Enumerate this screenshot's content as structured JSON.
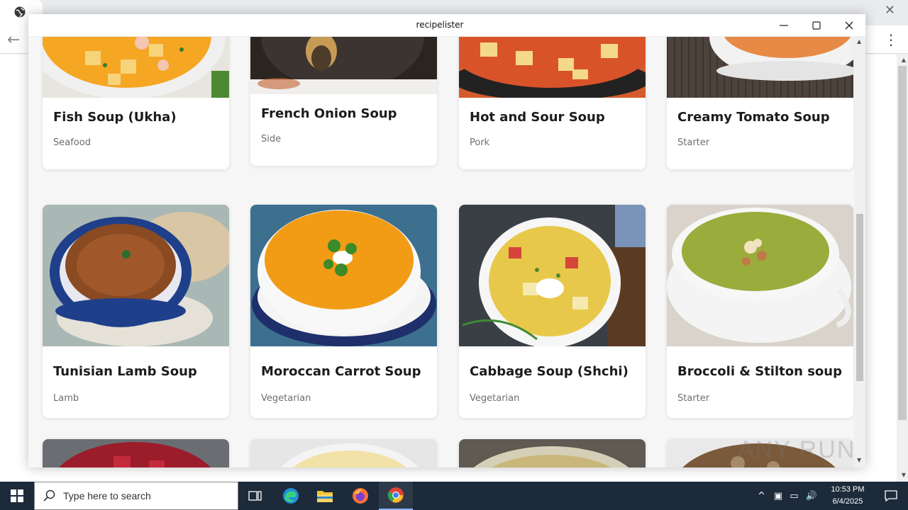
{
  "app": {
    "title": "recipelister"
  },
  "recipes": [
    {
      "name": "Fish Soup (Ukha)",
      "category": "Seafood"
    },
    {
      "name": "French Onion Soup",
      "category": "Side"
    },
    {
      "name": "Hot and Sour Soup",
      "category": "Pork"
    },
    {
      "name": "Creamy Tomato Soup",
      "category": "Starter"
    },
    {
      "name": "Tunisian Lamb Soup",
      "category": "Lamb"
    },
    {
      "name": "Moroccan Carrot Soup",
      "category": "Vegetarian"
    },
    {
      "name": "Cabbage Soup (Shchi)",
      "category": "Vegetarian"
    },
    {
      "name": "Broccoli & Stilton soup",
      "category": "Starter"
    }
  ],
  "taskbar": {
    "search_placeholder": "Type here to search",
    "time": "10:53 PM",
    "date": "6/4/2025"
  },
  "watermark": "ANY RUN"
}
